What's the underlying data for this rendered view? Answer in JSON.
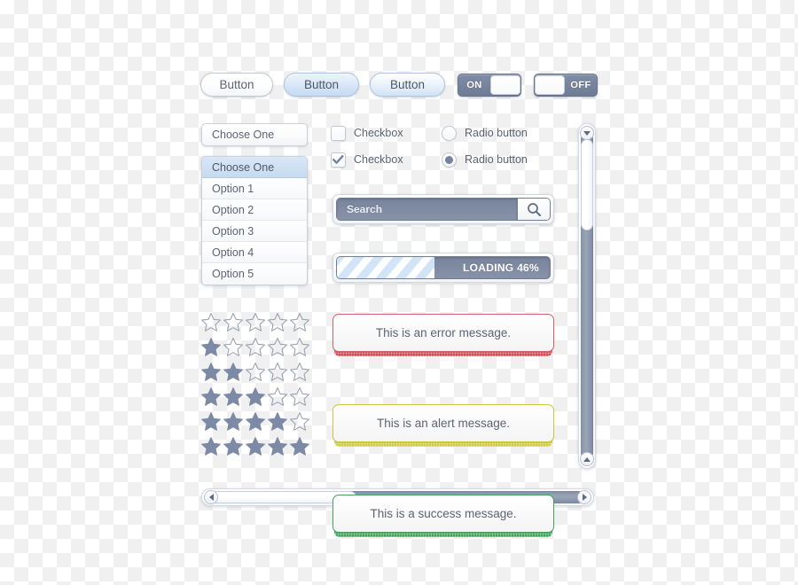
{
  "buttons": [
    {
      "label": "Button",
      "state": "default"
    },
    {
      "label": "Button",
      "state": "hover"
    },
    {
      "label": "Button",
      "state": "active"
    }
  ],
  "toggles": [
    {
      "label": "ON",
      "value": "on"
    },
    {
      "label": "OFF",
      "value": "off"
    }
  ],
  "select": {
    "value": "Choose One"
  },
  "listbox": {
    "items": [
      {
        "label": "Choose One",
        "selected": true
      },
      {
        "label": "Option 1",
        "selected": false
      },
      {
        "label": "Option 2",
        "selected": false
      },
      {
        "label": "Option 3",
        "selected": false
      },
      {
        "label": "Option 4",
        "selected": false
      },
      {
        "label": "Option 5",
        "selected": false
      }
    ]
  },
  "checkboxes": [
    {
      "label": "Checkbox",
      "checked": false
    },
    {
      "label": "Checkbox",
      "checked": true
    }
  ],
  "radios": [
    {
      "label": "Radio button",
      "checked": false
    },
    {
      "label": "Radio button",
      "checked": true
    }
  ],
  "search": {
    "value": "",
    "placeholder": "Search",
    "icon": "magnifier-icon"
  },
  "progress": {
    "label": "LOADING 46%",
    "percent": 46
  },
  "messages": [
    {
      "type": "error",
      "text": "This is an error message.",
      "border": "#d4626a",
      "bar": "#d44c55"
    },
    {
      "type": "alert",
      "text": "This is an alert message.",
      "border": "#cdc63f",
      "bar": "#d4cc3f"
    },
    {
      "type": "success",
      "text": "This is a success message.",
      "border": "#47a05f",
      "bar": "#3faa5e"
    }
  ],
  "ratings": {
    "max": 5,
    "rows": [
      0,
      1,
      2,
      3,
      4,
      5
    ],
    "filled_color": "#7d8aa6",
    "empty_color": "#9aa2b0"
  },
  "scrollbars": {
    "vertical": {
      "top_arrow": "chevron-down-icon",
      "bottom_arrow": "chevron-up-icon",
      "thumb_offset_pct": 2,
      "thumb_size_pct": 28
    },
    "horizontal": {
      "left_arrow": "chevron-left-icon",
      "right_arrow": "chevron-right-icon",
      "thumb_offset_pct": 0,
      "thumb_size_pct": 39
    }
  }
}
